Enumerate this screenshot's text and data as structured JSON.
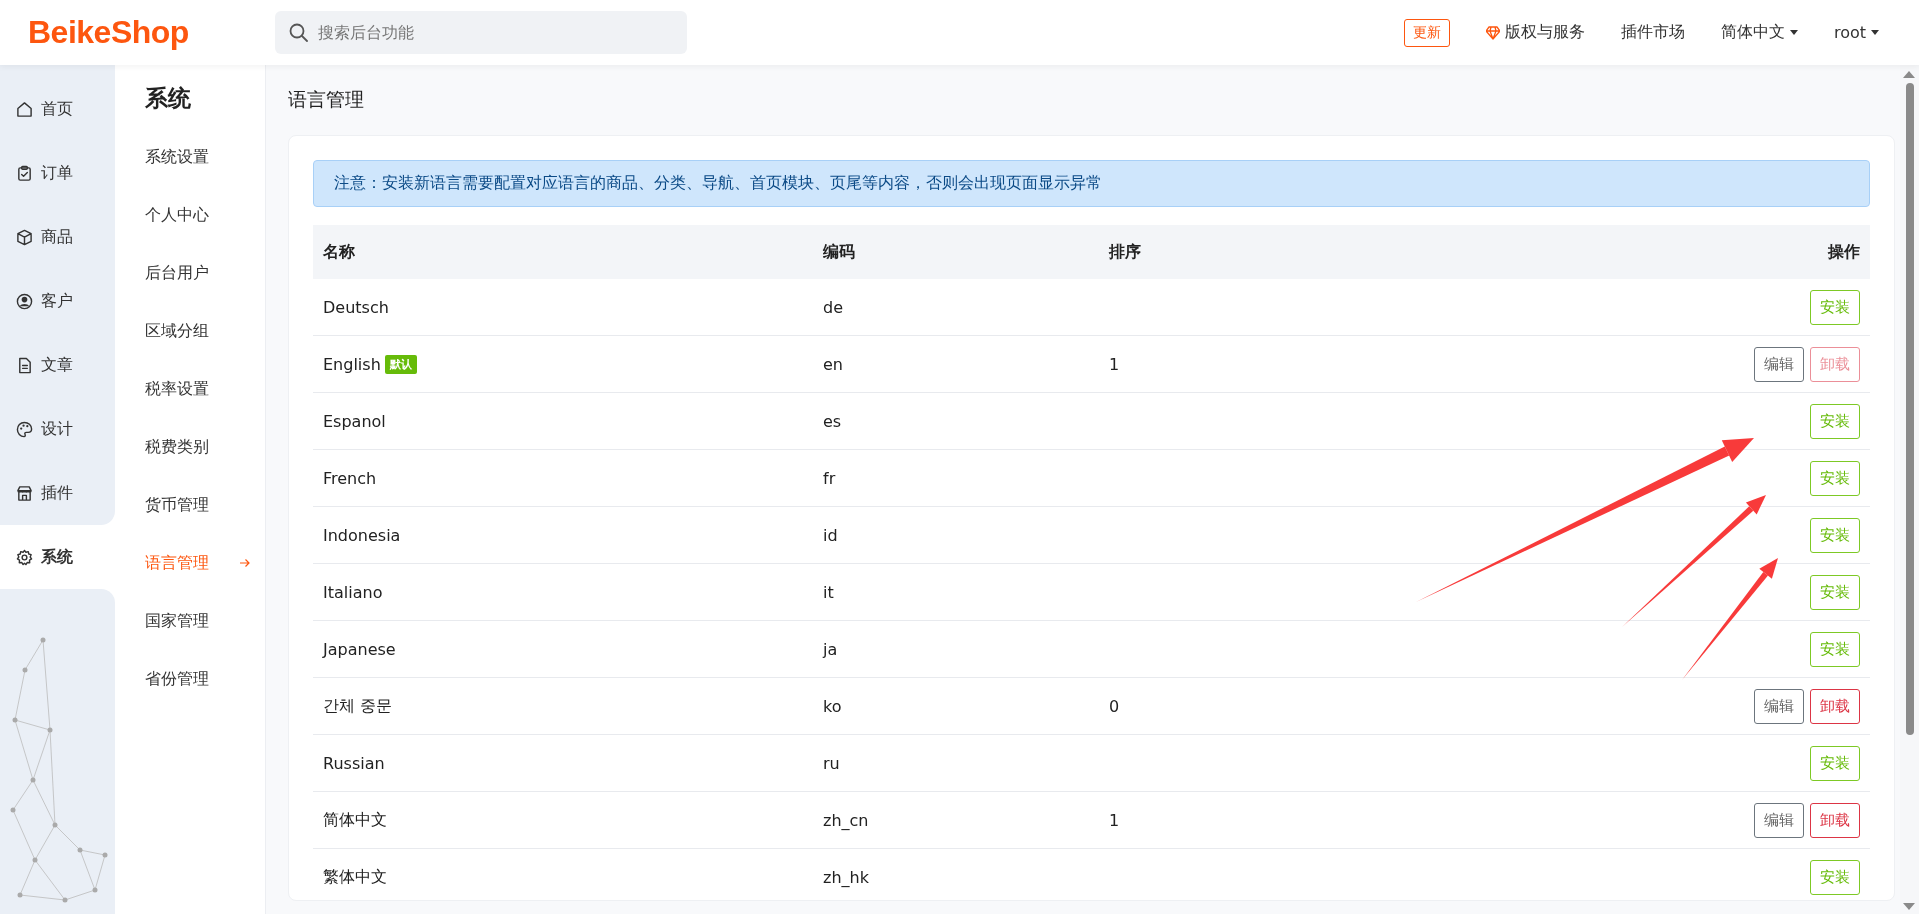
{
  "header": {
    "logo": "BeikeShop",
    "search": {
      "placeholder": "搜索后台功能"
    },
    "update_badge": "更新",
    "links": [
      {
        "label": "版权与服务",
        "kind": "gem"
      },
      {
        "label": "插件市场",
        "kind": "plain"
      },
      {
        "label": "简体中文",
        "kind": "dropdown"
      },
      {
        "label": "root",
        "kind": "dropdown"
      }
    ]
  },
  "nav": [
    {
      "label": "首页",
      "kind": "home",
      "selected": false
    },
    {
      "label": "订单",
      "kind": "clipboard",
      "selected": false
    },
    {
      "label": "商品",
      "kind": "box",
      "selected": false
    },
    {
      "label": "客户",
      "kind": "user",
      "selected": false
    },
    {
      "label": "文章",
      "kind": "doc",
      "selected": false
    },
    {
      "label": "设计",
      "kind": "palette",
      "selected": false
    },
    {
      "label": "插件",
      "kind": "shop",
      "selected": false
    },
    {
      "label": "系统",
      "kind": "gear",
      "selected": true
    }
  ],
  "submenu": {
    "title": "系统",
    "items": [
      {
        "label": "系统设置",
        "selected": false
      },
      {
        "label": "个人中心",
        "selected": false
      },
      {
        "label": "后台用户",
        "selected": false
      },
      {
        "label": "区域分组",
        "selected": false
      },
      {
        "label": "税率设置",
        "selected": false
      },
      {
        "label": "税费类别",
        "selected": false
      },
      {
        "label": "货币管理",
        "selected": false
      },
      {
        "label": "语言管理",
        "selected": true
      },
      {
        "label": "国家管理",
        "selected": false
      },
      {
        "label": "省份管理",
        "selected": false
      }
    ]
  },
  "page_title": "语言管理",
  "notice": "注意：安装新语言需要配置对应语言的商品、分类、导航、首页模块、页尾等内容，否则会出现页面显示异常",
  "table": {
    "columns": [
      "名称",
      "编码",
      "排序",
      "操作"
    ],
    "rows": [
      {
        "name": "Deutsch",
        "code": "de",
        "actions": [
          {
            "label": "安装",
            "kind": "install",
            "disabled": false
          }
        ]
      },
      {
        "name": "English",
        "badge": "默认",
        "code": "en",
        "sort": "1",
        "actions": [
          {
            "label": "编辑",
            "kind": "edit",
            "disabled": false
          },
          {
            "label": "卸载",
            "kind": "uninstall",
            "disabled": true
          }
        ]
      },
      {
        "name": "Espanol",
        "code": "es",
        "actions": [
          {
            "label": "安装",
            "kind": "install",
            "disabled": false
          }
        ]
      },
      {
        "name": "French",
        "code": "fr",
        "actions": [
          {
            "label": "安装",
            "kind": "install",
            "disabled": false
          }
        ]
      },
      {
        "name": "Indonesia",
        "code": "id",
        "actions": [
          {
            "label": "安装",
            "kind": "install",
            "disabled": false
          }
        ]
      },
      {
        "name": "Italiano",
        "code": "it",
        "actions": [
          {
            "label": "安装",
            "kind": "install",
            "disabled": false
          }
        ]
      },
      {
        "name": "Japanese",
        "code": "ja",
        "actions": [
          {
            "label": "安装",
            "kind": "install",
            "disabled": false
          }
        ]
      },
      {
        "name": "간체 중문",
        "code": "ko",
        "sort": "0",
        "actions": [
          {
            "label": "编辑",
            "kind": "edit",
            "disabled": false
          },
          {
            "label": "卸载",
            "kind": "uninstall",
            "disabled": false
          }
        ]
      },
      {
        "name": "Russian",
        "code": "ru",
        "actions": [
          {
            "label": "安装",
            "kind": "install",
            "disabled": false
          }
        ]
      },
      {
        "name": "简体中文",
        "code": "zh_cn",
        "sort": "1",
        "actions": [
          {
            "label": "编辑",
            "kind": "edit",
            "disabled": false
          },
          {
            "label": "卸载",
            "kind": "uninstall",
            "disabled": false
          }
        ]
      },
      {
        "name": "繁体中文",
        "code": "zh_hk",
        "actions": [
          {
            "label": "安装",
            "kind": "install",
            "disabled": false
          }
        ]
      }
    ]
  }
}
